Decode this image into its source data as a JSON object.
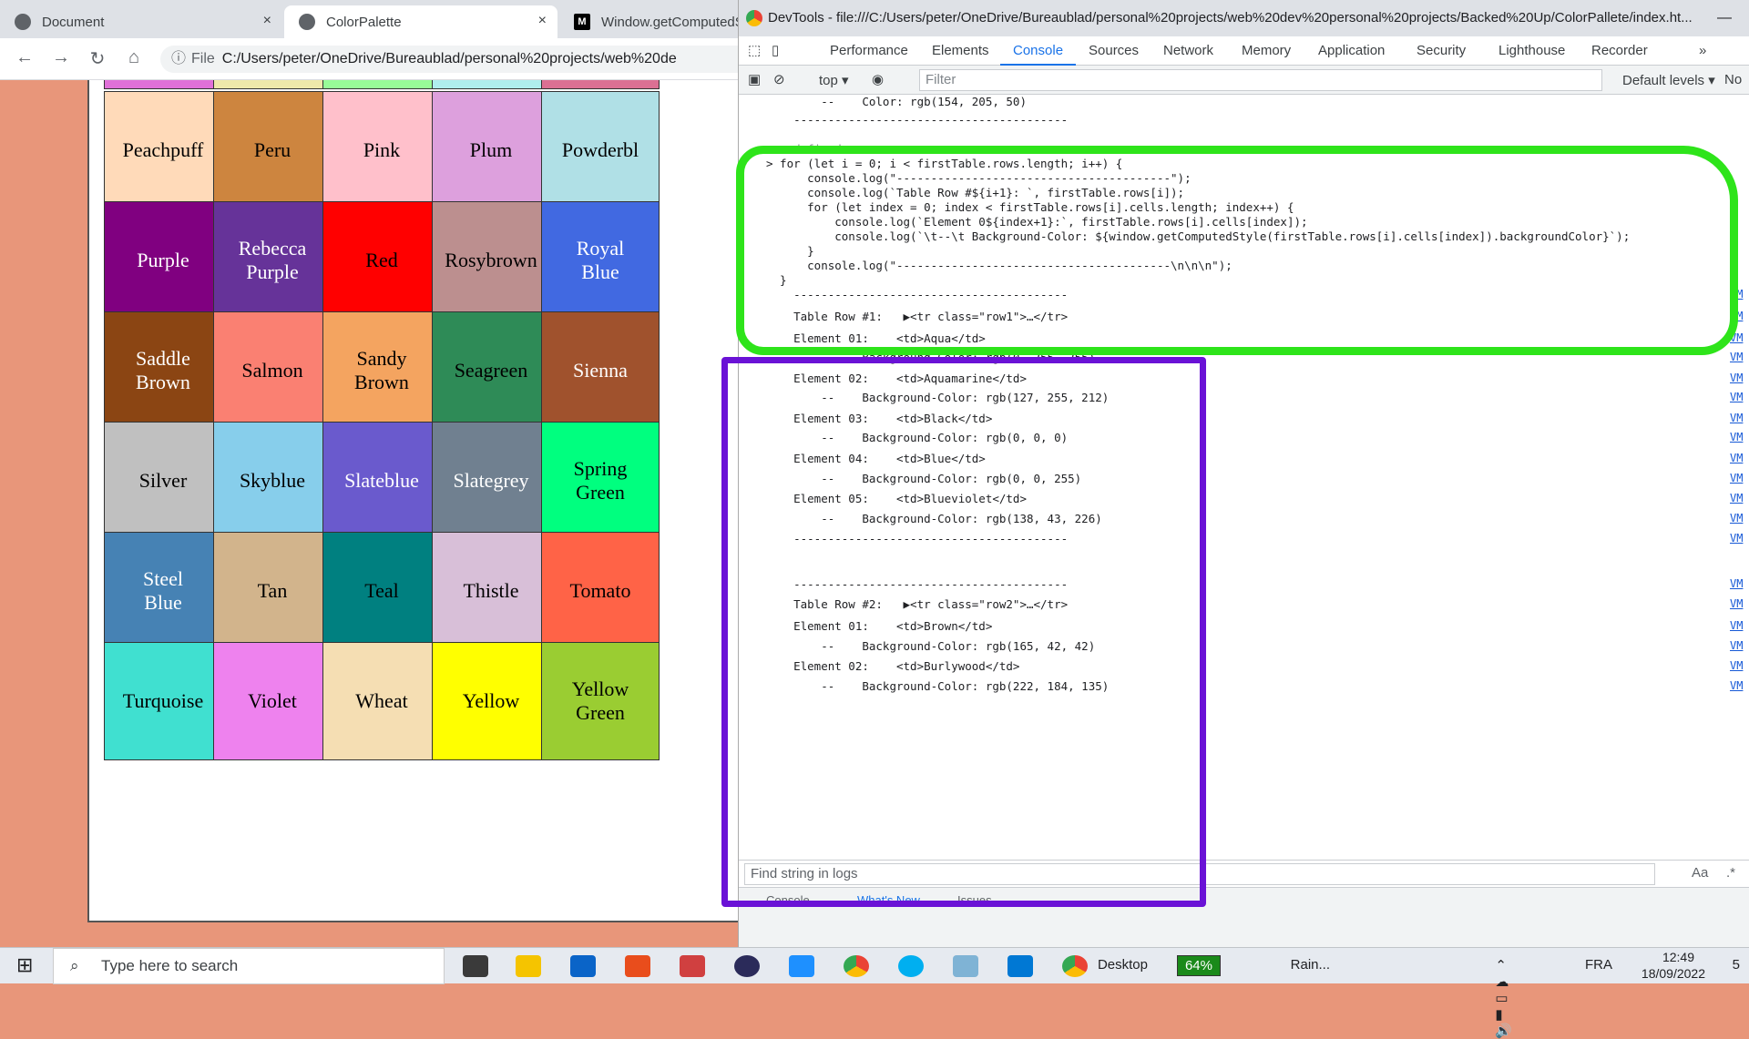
{
  "browser": {
    "tabs": [
      {
        "title": "Document",
        "close": "×"
      },
      {
        "title": "ColorPalette",
        "close": "×"
      },
      {
        "title": "Window.getComputedS",
        "icon": "M"
      }
    ],
    "address": {
      "file_label": "File",
      "url": "C:/Users/peter/OneDrive/Bureaublad/personal%20projects/web%20de"
    }
  },
  "palette": {
    "cells": [
      {
        "label": "Peachpuff",
        "bg": "#ffdab9",
        "fg": "#000"
      },
      {
        "label": "Peru",
        "bg": "#cd853f",
        "fg": "#000"
      },
      {
        "label": "Pink",
        "bg": "#ffc0cb",
        "fg": "#000"
      },
      {
        "label": "Plum",
        "bg": "#dda0dd",
        "fg": "#000"
      },
      {
        "label": "Powderbl",
        "bg": "#b0e0e6",
        "fg": "#000"
      },
      {
        "label": "Purple",
        "bg": "#800080",
        "fg": "#fff"
      },
      {
        "label": "Rebecca\nPurple",
        "bg": "#663399",
        "fg": "#fff"
      },
      {
        "label": "Red",
        "bg": "#ff0000",
        "fg": "#000"
      },
      {
        "label": "Rosybrown",
        "bg": "#bc8f8f",
        "fg": "#000"
      },
      {
        "label": "Royal\nBlue",
        "bg": "#4169e1",
        "fg": "#fff"
      },
      {
        "label": "Saddle\nBrown",
        "bg": "#8b4513",
        "fg": "#fff"
      },
      {
        "label": "Salmon",
        "bg": "#fa8072",
        "fg": "#000"
      },
      {
        "label": "Sandy\nBrown",
        "bg": "#f4a460",
        "fg": "#000"
      },
      {
        "label": "Seagreen",
        "bg": "#2e8b57",
        "fg": "#000"
      },
      {
        "label": "Sienna",
        "bg": "#a0522d",
        "fg": "#fff"
      },
      {
        "label": "Silver",
        "bg": "#c0c0c0",
        "fg": "#000"
      },
      {
        "label": "Skyblue",
        "bg": "#87ceeb",
        "fg": "#000"
      },
      {
        "label": "Slateblue",
        "bg": "#6a5acd",
        "fg": "#fff"
      },
      {
        "label": "Slategrey",
        "bg": "#708090",
        "fg": "#fff"
      },
      {
        "label": "Spring\nGreen",
        "bg": "#00ff7f",
        "fg": "#000"
      },
      {
        "label": "Steel\nBlue",
        "bg": "#4682b4",
        "fg": "#fff"
      },
      {
        "label": "Tan",
        "bg": "#d2b48c",
        "fg": "#000"
      },
      {
        "label": "Teal",
        "bg": "#008080",
        "fg": "#000"
      },
      {
        "label": "Thistle",
        "bg": "#d8bfd8",
        "fg": "#000"
      },
      {
        "label": "Tomato",
        "bg": "#ff6347",
        "fg": "#000"
      },
      {
        "label": "Turquoise",
        "bg": "#40e0d0",
        "fg": "#000"
      },
      {
        "label": "Violet",
        "bg": "#ee82ee",
        "fg": "#000"
      },
      {
        "label": "Wheat",
        "bg": "#f5deb3",
        "fg": "#000"
      },
      {
        "label": "Yellow",
        "bg": "#ffff00",
        "fg": "#000"
      },
      {
        "label": "Yellow\nGreen",
        "bg": "#9acd32",
        "fg": "#000"
      }
    ],
    "top_strip": [
      "#e070d8",
      "#eee8aa",
      "#98fb98",
      "#afeeee",
      "#db7093"
    ]
  },
  "devtools": {
    "title": "DevTools - file:///C:/Users/peter/OneDrive/Bureaublad/personal%20projects/web%20dev%20personal%20projects/Backed%20Up/ColorPallete/index.ht...",
    "tabs": [
      "Performance",
      "Elements",
      "Console",
      "Sources",
      "Network",
      "Memory",
      "Application",
      "Security",
      "Lighthouse",
      "Recorder"
    ],
    "active_tab": "Console",
    "context": "top",
    "filter_placeholder": "Filter",
    "levels": "Default levels",
    "no_label": "No",
    "find_placeholder": "Find string in logs",
    "drawer_tabs": [
      "Console",
      "What's New",
      "Issues"
    ],
    "vm_label": "VM"
  },
  "console_lines": [
    {
      "t": "        --    Color: rgb(154, 205, 50)"
    },
    {
      "t": "    ----------------------------------------"
    },
    {
      "t": "< undefined",
      "cls": "undef"
    },
    {
      "t": "> for (let i = 0; i < firstTable.rows.length; i++) {"
    },
    {
      "t": "      console.log(\"----------------------------------------\");"
    },
    {
      "t": "      console.log(`Table Row #${i+1}: `, firstTable.rows[i]);"
    },
    {
      "t": "      for (let index = 0; index < firstTable.rows[i].cells.length; index++) {"
    },
    {
      "t": "          console.log(`Element 0${index+1}:`, firstTable.rows[i].cells[index]);"
    },
    {
      "t": "          console.log(`\\t--\\t Background-Color: ${window.getComputedStyle(firstTable.rows[i].cells[index]).backgroundColor}`);"
    },
    {
      "t": "      }"
    },
    {
      "t": "      console.log(\"----------------------------------------\\n\\n\\n\");"
    },
    {
      "t": "  }"
    },
    {
      "t": "    ----------------------------------------"
    },
    {
      "t": "    Table Row #1:   ▶<tr class=\"row1\">…</tr>"
    },
    {
      "t": "    Element 01:    <td>Aqua</td>"
    },
    {
      "t": "        --    Background-Color: rgb(0, 255, 255)"
    },
    {
      "t": "    Element 02:    <td>Aquamarine</td>"
    },
    {
      "t": "        --    Background-Color: rgb(127, 255, 212)"
    },
    {
      "t": "    Element 03:    <td>Black</td>"
    },
    {
      "t": "        --    Background-Color: rgb(0, 0, 0)"
    },
    {
      "t": "    Element 04:    <td>Blue</td>"
    },
    {
      "t": "        --    Background-Color: rgb(0, 0, 255)"
    },
    {
      "t": "    Element 05:    <td>Blueviolet</td>"
    },
    {
      "t": "        --    Background-Color: rgb(138, 43, 226)"
    },
    {
      "t": "    ----------------------------------------"
    },
    {
      "t": ""
    },
    {
      "t": "    ----------------------------------------"
    },
    {
      "t": "    Table Row #2:   ▶<tr class=\"row2\">…</tr>"
    },
    {
      "t": "    Element 01:    <td>Brown</td>"
    },
    {
      "t": "        --    Background-Color: rgb(165, 42, 42)"
    },
    {
      "t": "    Element 02:    <td>Burlywood</td>"
    },
    {
      "t": "        --    Background-Color: rgb(222, 184, 135)"
    }
  ],
  "taskbar": {
    "search_placeholder": "Type here to search",
    "desktop": "Desktop",
    "battery": "64%",
    "weather": "Rain...",
    "lang": "FRA",
    "time": "12:49",
    "date": "18/09/2022",
    "notif": "5"
  },
  "colors": {
    "annotation_green": "#2ee41a",
    "annotation_purple": "#6a12d6",
    "accent": "#1a73e8"
  }
}
